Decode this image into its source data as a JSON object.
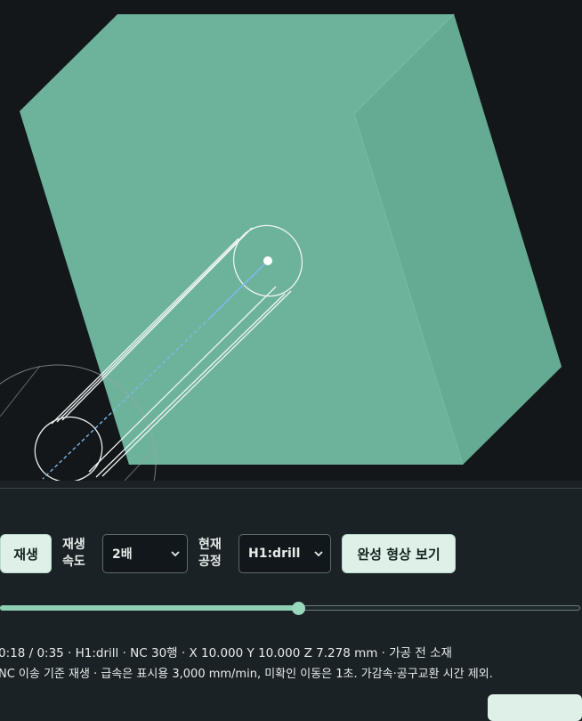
{
  "controls": {
    "play_label": "재생",
    "speed_label": "재생\n속도",
    "speed_value": "2배",
    "operation_label": "현재\n공정",
    "operation_value": "H1:drill",
    "final_shape_label": "완성 형상 보기"
  },
  "timeline": {
    "progress_fraction": 0.514
  },
  "status": {
    "line": "0:18 / 0:35 · H1:drill · NC 30행 · X 10.000 Y 10.000 Z 7.278 mm · 가공 전 소재",
    "note": "NC 이송 기준 재생 · 급속은 표시용 3,000 mm/min, 미확인 이동은 1초. 가감속·공구교환 시간 제외."
  },
  "colors": {
    "stock_face": "#6db39b",
    "viewport_bg": "#131719",
    "accent": "#8ed0b3"
  },
  "icons": {
    "select_chevron": "chevron-down-icon"
  }
}
